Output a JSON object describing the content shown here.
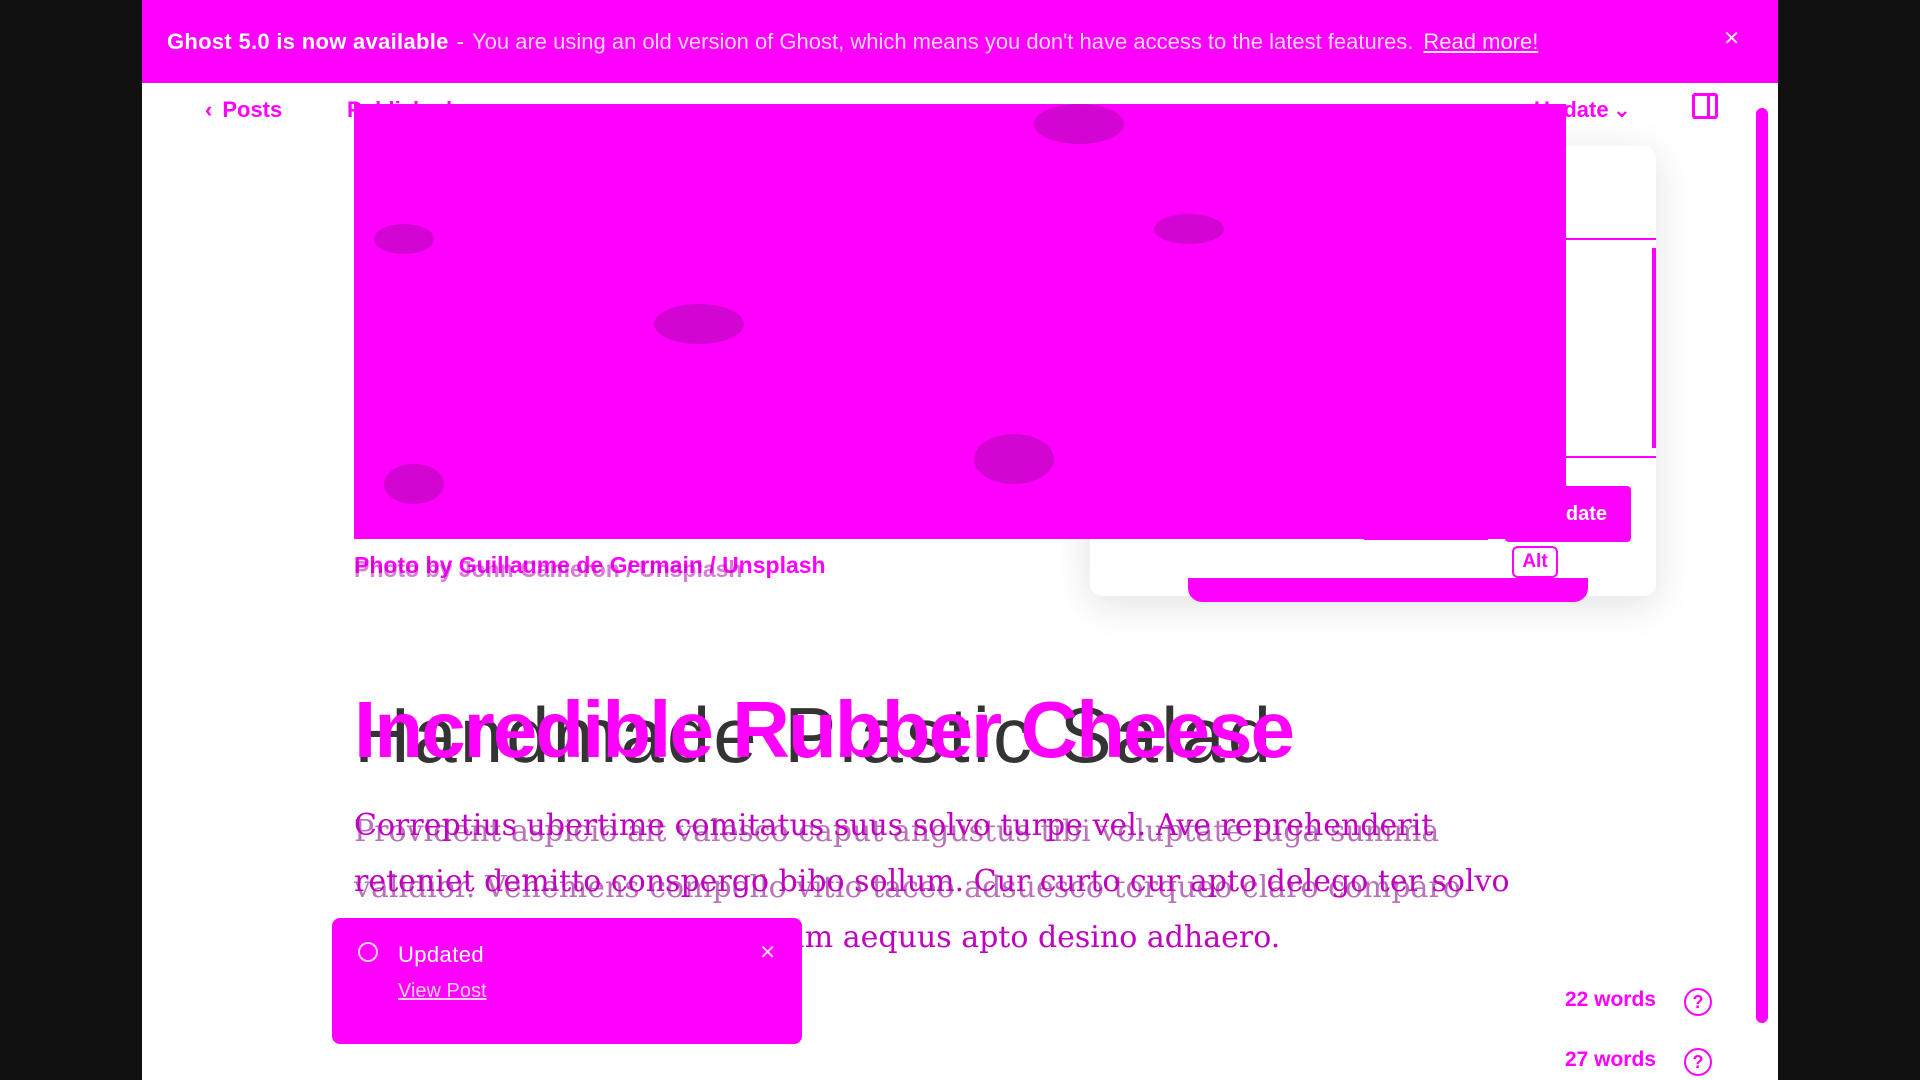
{
  "banner": {
    "title": "Ghost 5.0 is now available",
    "separator": "-",
    "message": "You are using an old version of Ghost, which means you don't have access to the latest features.",
    "link": "Read more!",
    "close_icon": "close-icon"
  },
  "header": {
    "back_label": "Posts",
    "back_icon": "chevron-left-icon",
    "status": "Published",
    "update_menu": "Update",
    "update_menu_icon": "chevron-down-icon",
    "sidebar_icon": "sidebar-toggle-icon"
  },
  "feature_image": {
    "caption": "Photo by Guillaume de Germain / Unsplash",
    "caption_ghost": "Photo by John Cameron / Unsplash"
  },
  "popover": {
    "update_label": "Update",
    "alt_label": "Alt"
  },
  "post": {
    "title": "Incredible Rubber Cheese",
    "title_ghost": "Handmade Plastic Salad",
    "paragraph_1": "Correptius ubertime comitatus suus solvo turpe vel. Ave reprehenderit reteniet demitto conspergo bibo sollum. Cur curto cur apto delego ter solvo voletius. Asperiores neque eum aequus apto desino adhaero.",
    "paragraph_2": "Provident aspicio ait valesco caput angustus tibi voluptate fuga summa validior. Vehemens compello vitio taceo adsuesco torqueo claro comparo velut apostolus."
  },
  "toast": {
    "label": "Updated",
    "link": "View Post",
    "close_icon": "close-icon",
    "status_icon": "check-circle-icon"
  },
  "word_counts": {
    "count_1": "22 words",
    "count_2": "27 words",
    "help_icon": "help-circle-icon",
    "help_glyph": "?"
  },
  "colors": {
    "accent": "#ff00ff",
    "background": "#111111",
    "surface": "#ffffff"
  }
}
